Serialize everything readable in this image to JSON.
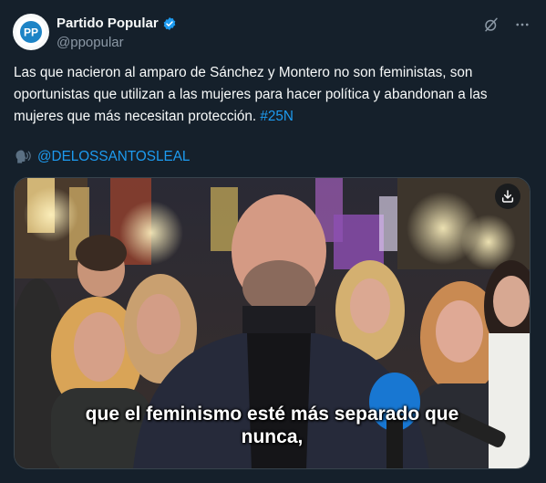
{
  "author": {
    "display_name": "Partido Popular",
    "handle": "@ppopular",
    "avatar_text": "PP"
  },
  "tweet": {
    "text_main": "Las que nacieron al amparo de Sánchez y Montero no son feministas, son oportunistas que utilizan a las mujeres para hacer política y abandonan a las mujeres que más necesitan protección.",
    "hashtag": "#25N",
    "mention_emoji": "speaking-head-icon",
    "mention": "@DELOSSANTOSLEAL"
  },
  "media": {
    "caption_line1": "que el feminismo esté más separado que",
    "caption_line2": "nunca,"
  },
  "colors": {
    "background": "#15202b",
    "link": "#1d9bf0",
    "secondary_text": "#8b98a5",
    "verified": "#1d9bf0"
  }
}
